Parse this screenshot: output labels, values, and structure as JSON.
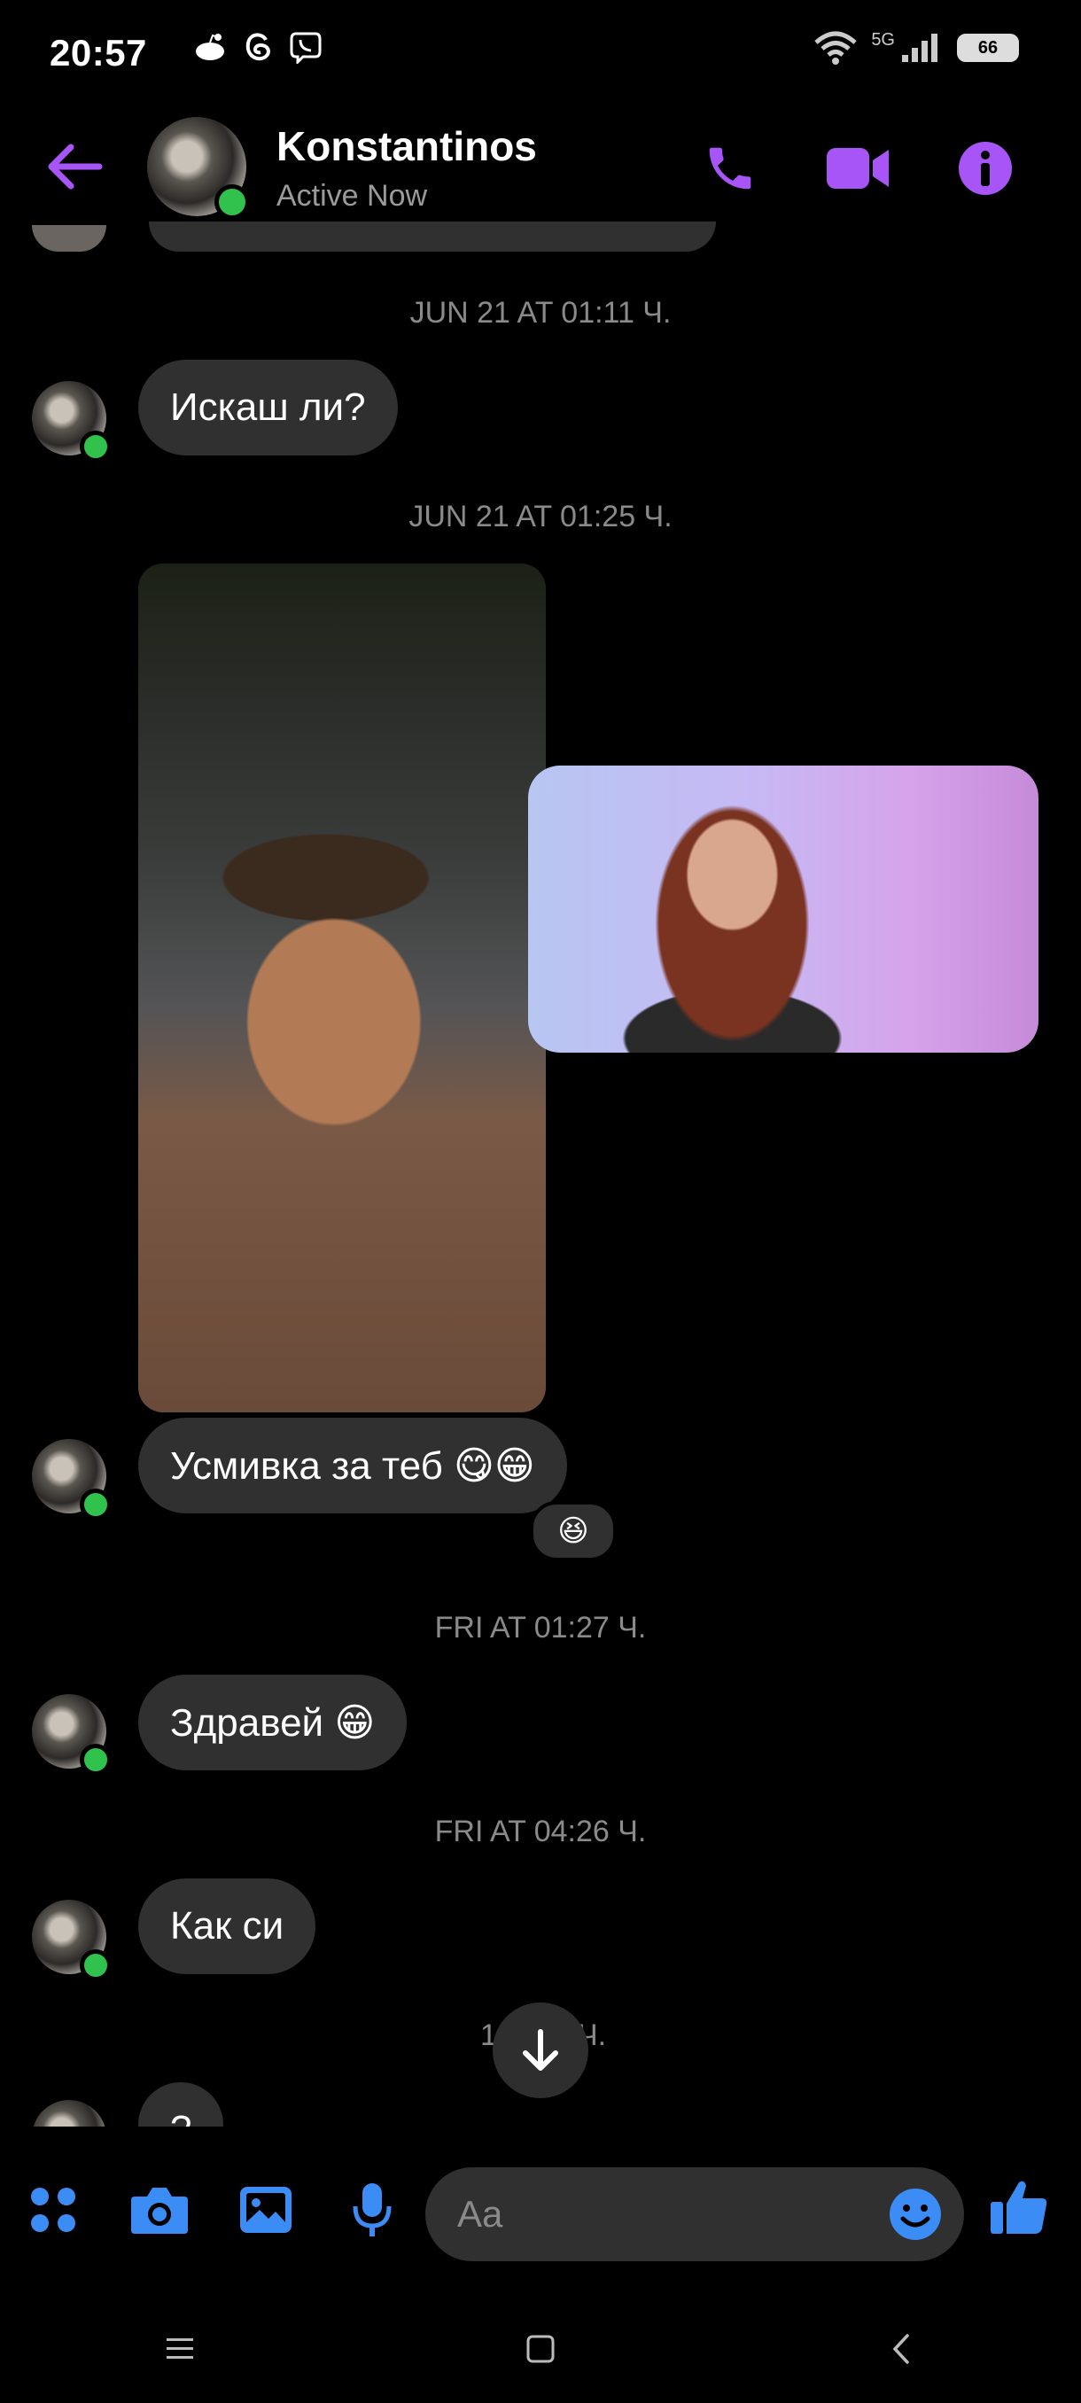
{
  "status_bar": {
    "time": "20:57",
    "network": "5G",
    "battery": "66"
  },
  "header": {
    "contact_name": "Konstantinos",
    "contact_status": "Active Now"
  },
  "messages": {
    "ts1": "JUN 21 AT 01:11 Ч.",
    "m1": "Искаш ли?",
    "ts2": "JUN 21 AT 01:25 Ч.",
    "m2": "Усмивка за теб 😋😁",
    "m2_reaction": "😆",
    "ts3": "FRI AT 01:27 Ч.",
    "m3": "Здравей 😁",
    "ts4": "FRI AT 04:26 Ч.",
    "m4": "Как си",
    "ts5_partial": "1",
    "ts5_partial_end": "Ч.",
    "m5_partial": "?"
  },
  "composer": {
    "placeholder": "Aa"
  },
  "colors": {
    "accent_purple": "#a855f7",
    "accent_blue": "#3b8cf5",
    "online_green": "#31c24d",
    "bubble": "#303030"
  }
}
